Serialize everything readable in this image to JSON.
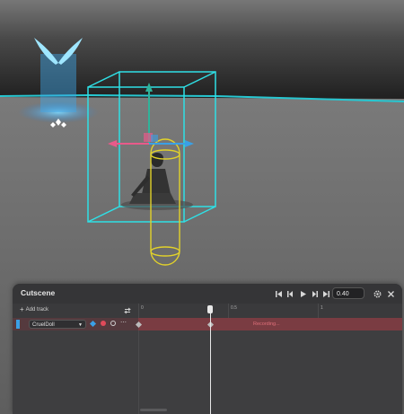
{
  "viewport": {
    "colors": {
      "sky": "#3a3a3a",
      "ground": "#6b6b6b",
      "horizon": "#27c7d1",
      "bounds_box": "#2fe0e6",
      "collider": "#e2d22a",
      "axis_x": "#3aa0e6",
      "axis_y": "#2fb39a",
      "axis_z": "#e85a8a"
    }
  },
  "cutscene": {
    "title": "Cutscene",
    "controls": {
      "jump_start_icon": "skip-start-icon",
      "prev_icon": "step-back-icon",
      "play_icon": "play-icon",
      "next_icon": "step-forward-icon",
      "jump_end_icon": "skip-end-icon",
      "time_value": "0.40",
      "settings_icon": "gear-icon",
      "close_icon": "close-icon"
    },
    "add_track_label": "Add track",
    "timeline": {
      "ticks": [
        "0",
        "0.5",
        "1"
      ]
    },
    "tracks": [
      {
        "name": "CruelDoll",
        "status": "Recording..."
      }
    ]
  }
}
